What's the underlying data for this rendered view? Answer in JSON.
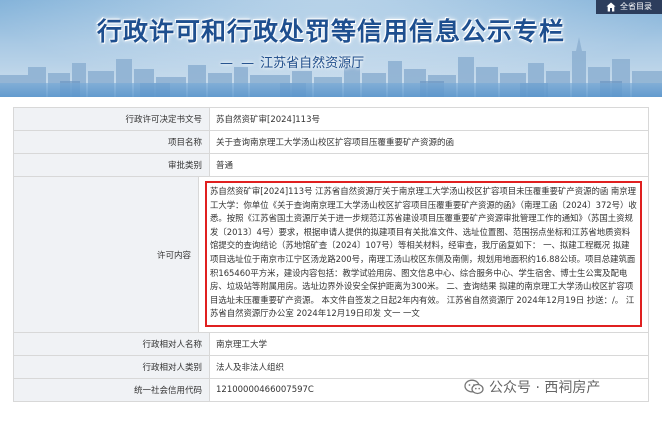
{
  "banner": {
    "title": "行政许可和行政处罚等信用信息公示专栏",
    "subtitle": "江苏省自然资源厅",
    "subtitle_prefix": "— —"
  },
  "top_nav": {
    "home_label": "全省目录",
    "icon": "home-icon"
  },
  "table": {
    "rows": [
      {
        "label": "行政许可决定书文号",
        "value": "苏自然资矿审[2024]113号"
      },
      {
        "label": "项目名称",
        "value": "关于查询南京理工大学汤山校区扩容项目压覆重要矿产资源的函"
      },
      {
        "label": "审批类别",
        "value": "普通"
      },
      {
        "label": "许可内容",
        "value": "苏自然资矿审[2024]113号 江苏省自然资源厅关于南京理工大学汤山校区扩容项目未压覆重要矿产资源的函 南京理工大学：你单位《关于查询南京理工大学汤山校区扩容项目压覆重要矿产资源的函》（南理工函〔2024〕372号）收悉。按照《江苏省国土资源厅关于进一步规范江苏省建设项目压覆重要矿产资源审批管理工作的通知》（苏国土资规发〔2013〕4号）要求，根据申请人提供的拟建项目有关批准文件、选址位置图、范围拐点坐标和江苏省地质资料馆提交的查询结论（苏地馆矿查〔2024〕107号）等相关材料，经审查，我厅函复如下： 一、拟建工程概况 拟建项目选址位于南京市江宁区汤龙路200号，南理工汤山校区东侧及南侧，规划用地面积约16.88公顷。项目总建筑面积165460平方米，建设内容包括：教学试验用房、图文信息中心、综合服务中心、学生宿舍、博士生公寓及配电房、垃圾站等附属用房。选址边界外设安全保护距离为300米。 二、查询结果 拟建的南京理工大学汤山校区扩容项目选址未压覆重要矿产资源。 本文件自签发之日起2年内有效。 江苏省自然资源厅 2024年12月19日 抄送：/。 江苏省自然资源厅办公室 2024年12月19日印发 文一 一文"
      },
      {
        "label": "行政相对人名称",
        "value": "南京理工大学"
      },
      {
        "label": "行政相对人类别",
        "value": "法人及非法人组织"
      },
      {
        "label": "统一社会信用代码",
        "value": "12100000466007597C"
      }
    ]
  },
  "watermark": {
    "text": "公众号 · 西祠房产",
    "icon": "wechat-icon"
  },
  "colors": {
    "banner_title": "#1e4f8f",
    "highlight_border": "#e02020",
    "label_bg": "#f0f2f5",
    "top_nav_bg": "#2c3d5c"
  }
}
